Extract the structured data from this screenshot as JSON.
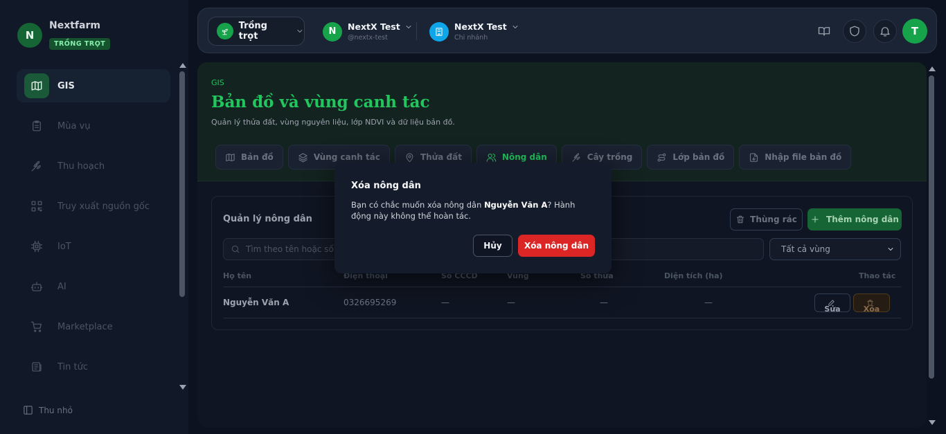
{
  "brand": {
    "logo_letter": "N",
    "name": "Nextfarm",
    "badge": "TRỒNG TRỌT"
  },
  "sidebar": {
    "items": [
      {
        "label": "GIS",
        "icon": "map-icon",
        "active": true
      },
      {
        "label": "Mùa vụ",
        "icon": "clipboard-icon"
      },
      {
        "label": "Thu hoạch",
        "icon": "wheat-icon"
      },
      {
        "label": "Truy xuất nguồn gốc",
        "icon": "qr-code-icon"
      },
      {
        "label": "IoT",
        "icon": "chip-icon"
      },
      {
        "label": "AI",
        "icon": "bot-icon"
      },
      {
        "label": "Marketplace",
        "icon": "cart-icon"
      },
      {
        "label": "Tin tức",
        "icon": "newspaper-icon"
      }
    ],
    "collapse_label": "Thu nhỏ"
  },
  "topbar": {
    "crop_selector": "Trồng trọt",
    "org": {
      "letter": "N",
      "name": "NextX Test",
      "handle": "@nextx-test"
    },
    "branch": {
      "name": "NextX Test",
      "sub": "Chi nhánh"
    },
    "avatar_letter": "T",
    "colors": {
      "accent": "#16a34a",
      "branch": "#0ea5e9"
    }
  },
  "hero": {
    "eyebrow": "GIS",
    "title": "Bản đồ và vùng canh tác",
    "description": "Quản lý thửa đất, vùng nguyên liệu, lớp NDVI và dữ liệu bản đồ."
  },
  "tabs": [
    {
      "label": "Bản đồ",
      "icon": "map-icon"
    },
    {
      "label": "Vùng canh tác",
      "icon": "layers-icon"
    },
    {
      "label": "Thửa đất",
      "icon": "map-pin-icon"
    },
    {
      "label": "Nông dân",
      "icon": "users-icon",
      "active": true
    },
    {
      "label": "Cây trồng",
      "icon": "sprout-icon"
    },
    {
      "label": "Lớp bản đồ",
      "icon": "route-icon"
    },
    {
      "label": "Nhập file bản đồ",
      "icon": "file-import-icon"
    }
  ],
  "farmers": {
    "title": "Quản lý nông dân",
    "trash_label": "Thùng rác",
    "add_label": "Thêm nông dân",
    "search_placeholder": "Tìm theo tên hoặc số điện thoại",
    "region_filter": "Tất cả vùng",
    "columns": [
      "Họ tên",
      "Điện thoại",
      "Số CCCD",
      "Vùng",
      "Số thửa",
      "Diện tích (ha)",
      "Thao tác"
    ],
    "rows": [
      {
        "name": "Nguyễn Văn A",
        "phone": "0326695269",
        "cccd": "—",
        "region": "—",
        "plots": "—",
        "area": "—"
      }
    ],
    "edit_label": "Sửa",
    "delete_label": "Xóa"
  },
  "modal": {
    "title": "Xóa nông dân",
    "message_prefix": "Bạn có chắc muốn xóa nông dân ",
    "farmer_name": "Nguyễn Văn A",
    "message_suffix": "? Hành động này không thể hoàn tác.",
    "cancel_label": "Hủy",
    "confirm_label": "Xóa nông dân",
    "confirm_color": "#dc2626"
  }
}
